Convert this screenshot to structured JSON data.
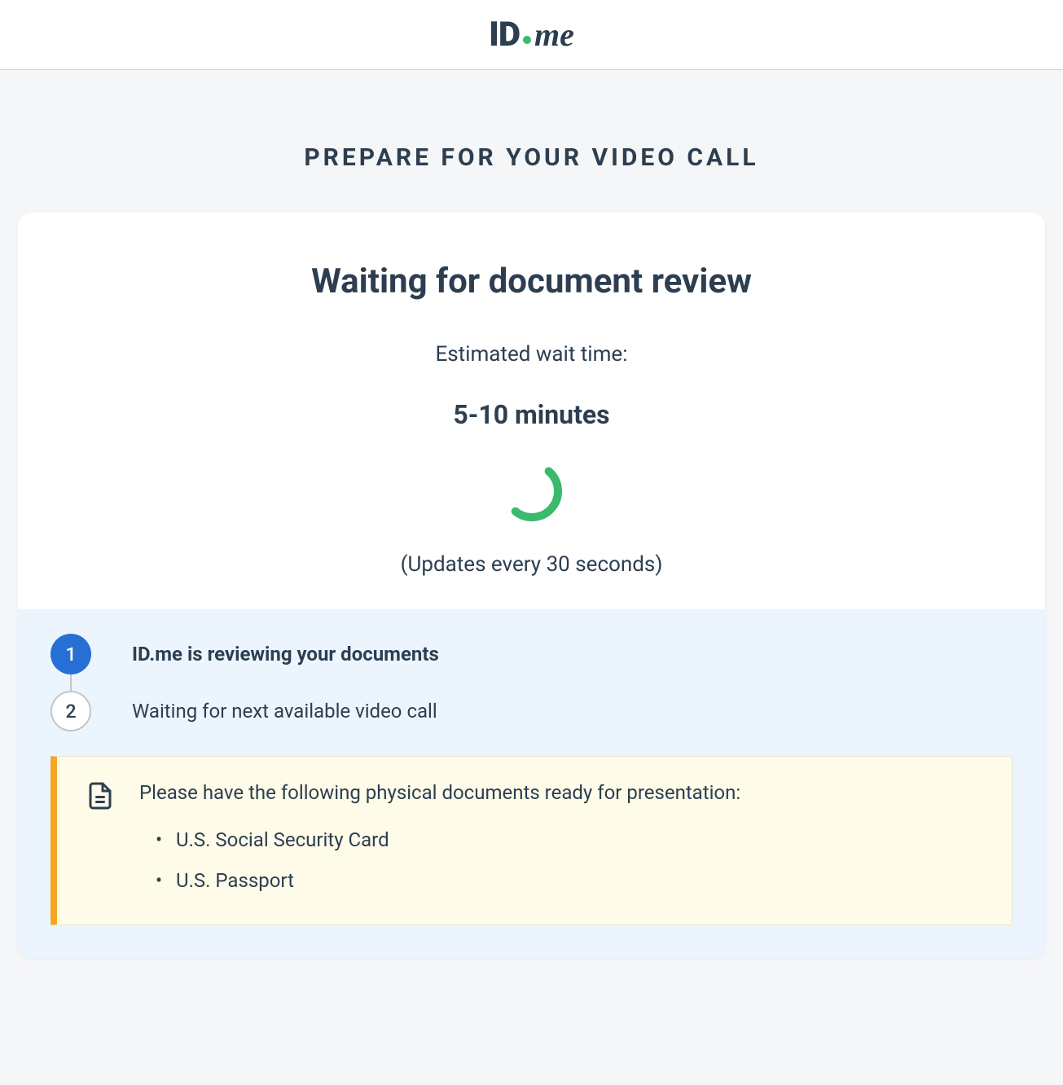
{
  "logo": {
    "id_text": "ID",
    "me_text": "me"
  },
  "page_title": "PREPARE FOR YOUR VIDEO CALL",
  "card": {
    "heading": "Waiting for document review",
    "wait_label": "Estimated wait time:",
    "wait_time": "5-10 minutes",
    "updates_text": "(Updates every 30 seconds)"
  },
  "steps": [
    {
      "number": "1",
      "label": "ID.me is reviewing your documents",
      "active": true
    },
    {
      "number": "2",
      "label": "Waiting for next available video call",
      "active": false
    }
  ],
  "notice": {
    "text": "Please have the following physical documents ready for presentation:",
    "items": [
      "U.S. Social Security Card",
      "U.S. Passport"
    ]
  }
}
